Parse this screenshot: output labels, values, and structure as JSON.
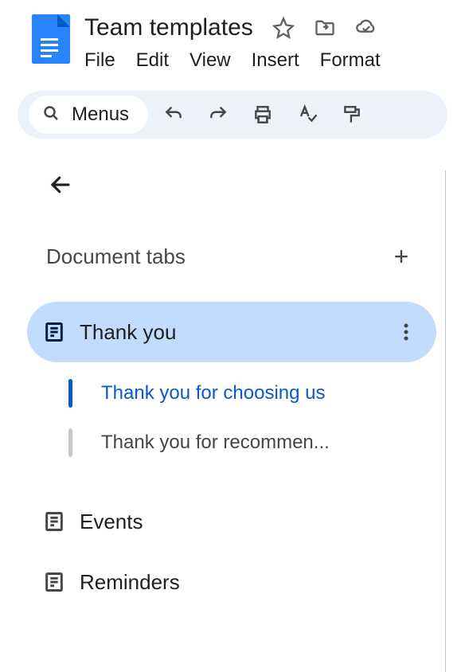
{
  "header": {
    "doc_title": "Team templates"
  },
  "menubar": [
    "File",
    "Edit",
    "View",
    "Insert",
    "Format"
  ],
  "toolbar": {
    "search_label": "Menus"
  },
  "panel": {
    "title": "Document tabs",
    "tabs": [
      {
        "label": "Thank you",
        "active": true
      },
      {
        "label": "Events",
        "active": false
      },
      {
        "label": "Reminders",
        "active": false
      }
    ],
    "outline": [
      {
        "label": "Thank you for choosing us",
        "active": true
      },
      {
        "label": "Thank you for recommen...",
        "active": false
      }
    ]
  }
}
